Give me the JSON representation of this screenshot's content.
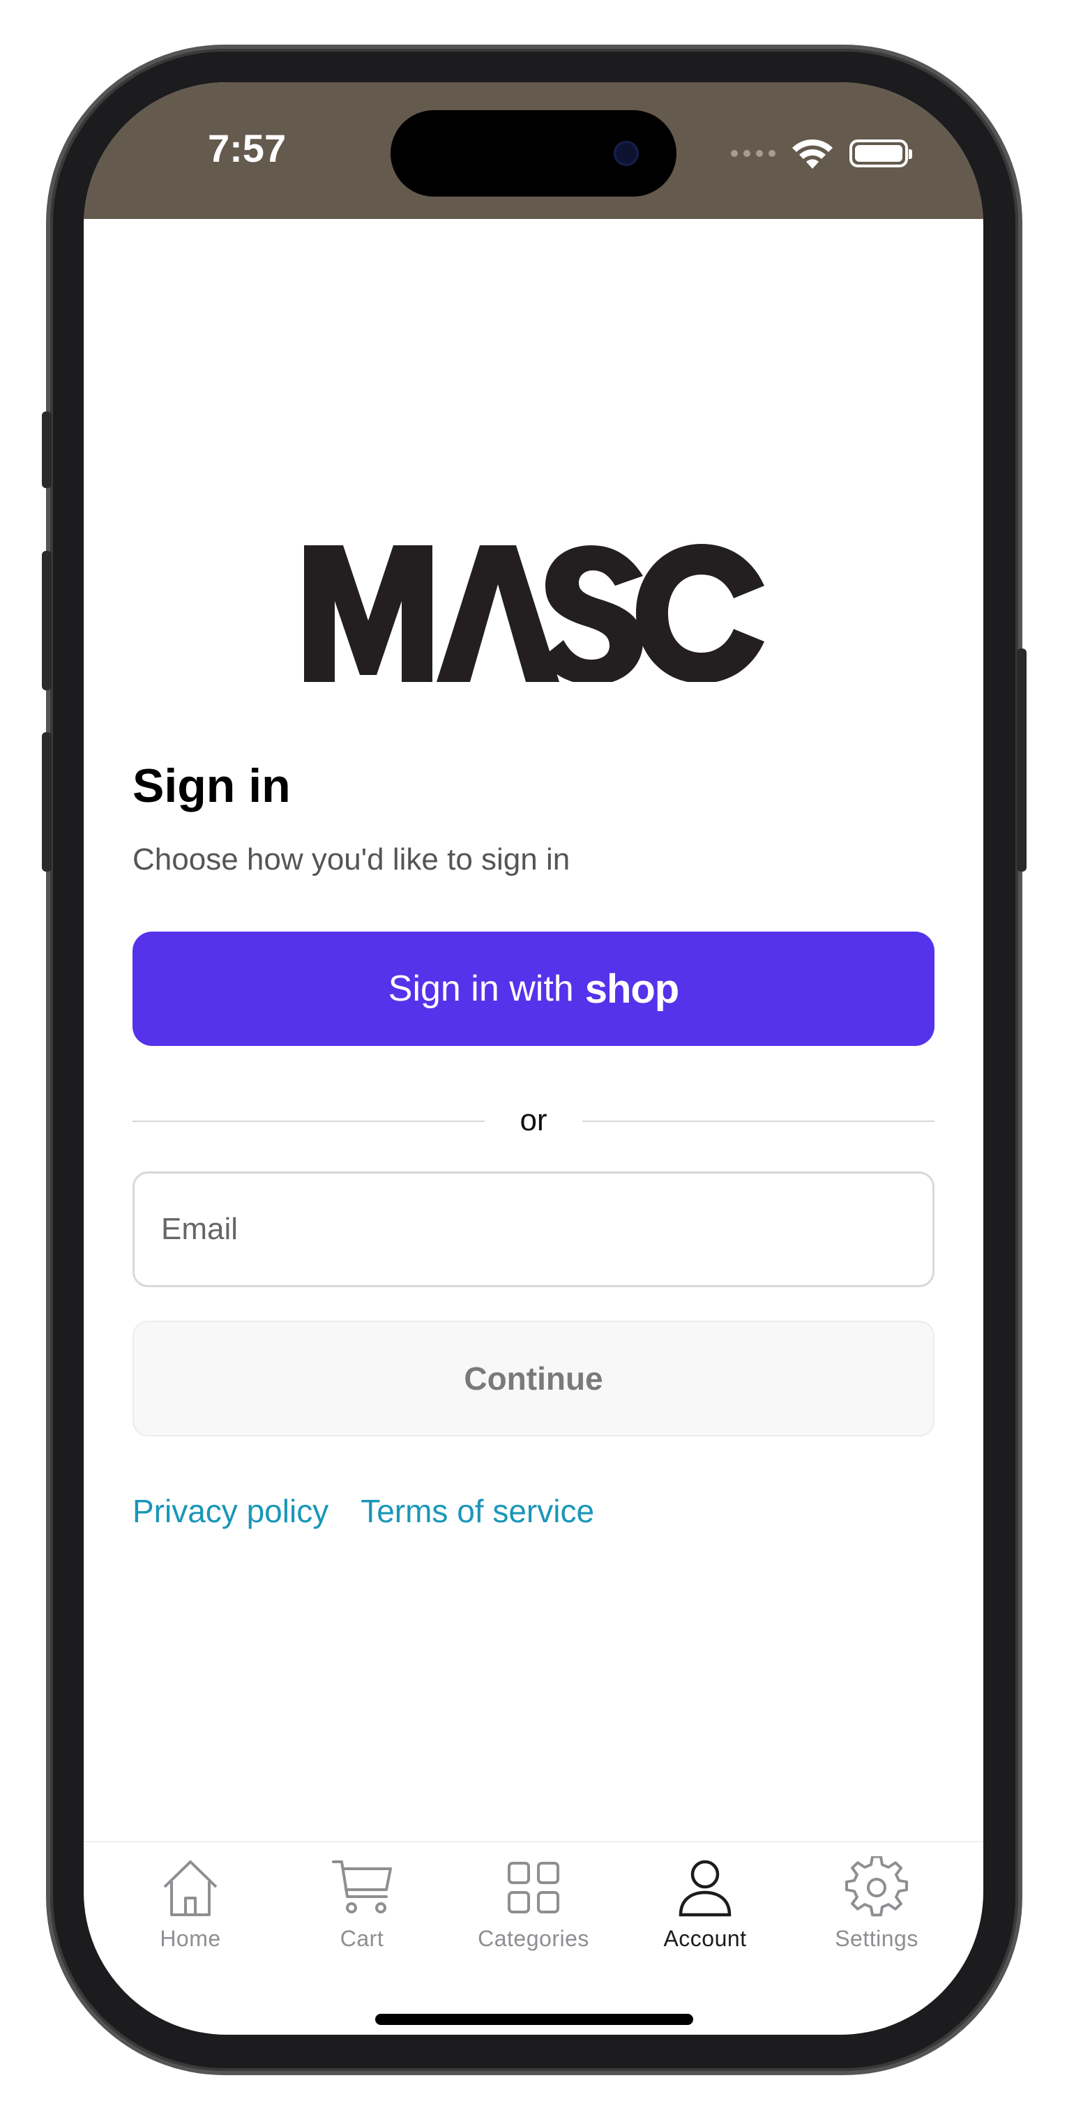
{
  "status_bar": {
    "time": "7:57",
    "background": "#645a4d",
    "icons": [
      "cellular-signal-icon",
      "wifi-icon",
      "battery-icon"
    ]
  },
  "brand": {
    "logo_text": "MASC",
    "logo_color": "#231f20"
  },
  "signin": {
    "title": "Sign in",
    "subtitle": "Choose how you'd like to sign in",
    "shop_button_prefix": "Sign in with",
    "shop_button_brand": "shop",
    "shop_button_color": "#5433eb",
    "divider_text": "or",
    "email_placeholder": "Email",
    "email_value": "",
    "continue_label": "Continue"
  },
  "footer_links": {
    "privacy": "Privacy policy",
    "terms": "Terms of service",
    "link_color": "#1a96b8"
  },
  "tabbar": {
    "active": "Account",
    "items": [
      {
        "label": "Home",
        "icon": "home-icon"
      },
      {
        "label": "Cart",
        "icon": "cart-icon"
      },
      {
        "label": "Categories",
        "icon": "categories-grid-icon"
      },
      {
        "label": "Account",
        "icon": "user-icon"
      },
      {
        "label": "Settings",
        "icon": "gear-icon"
      }
    ]
  }
}
